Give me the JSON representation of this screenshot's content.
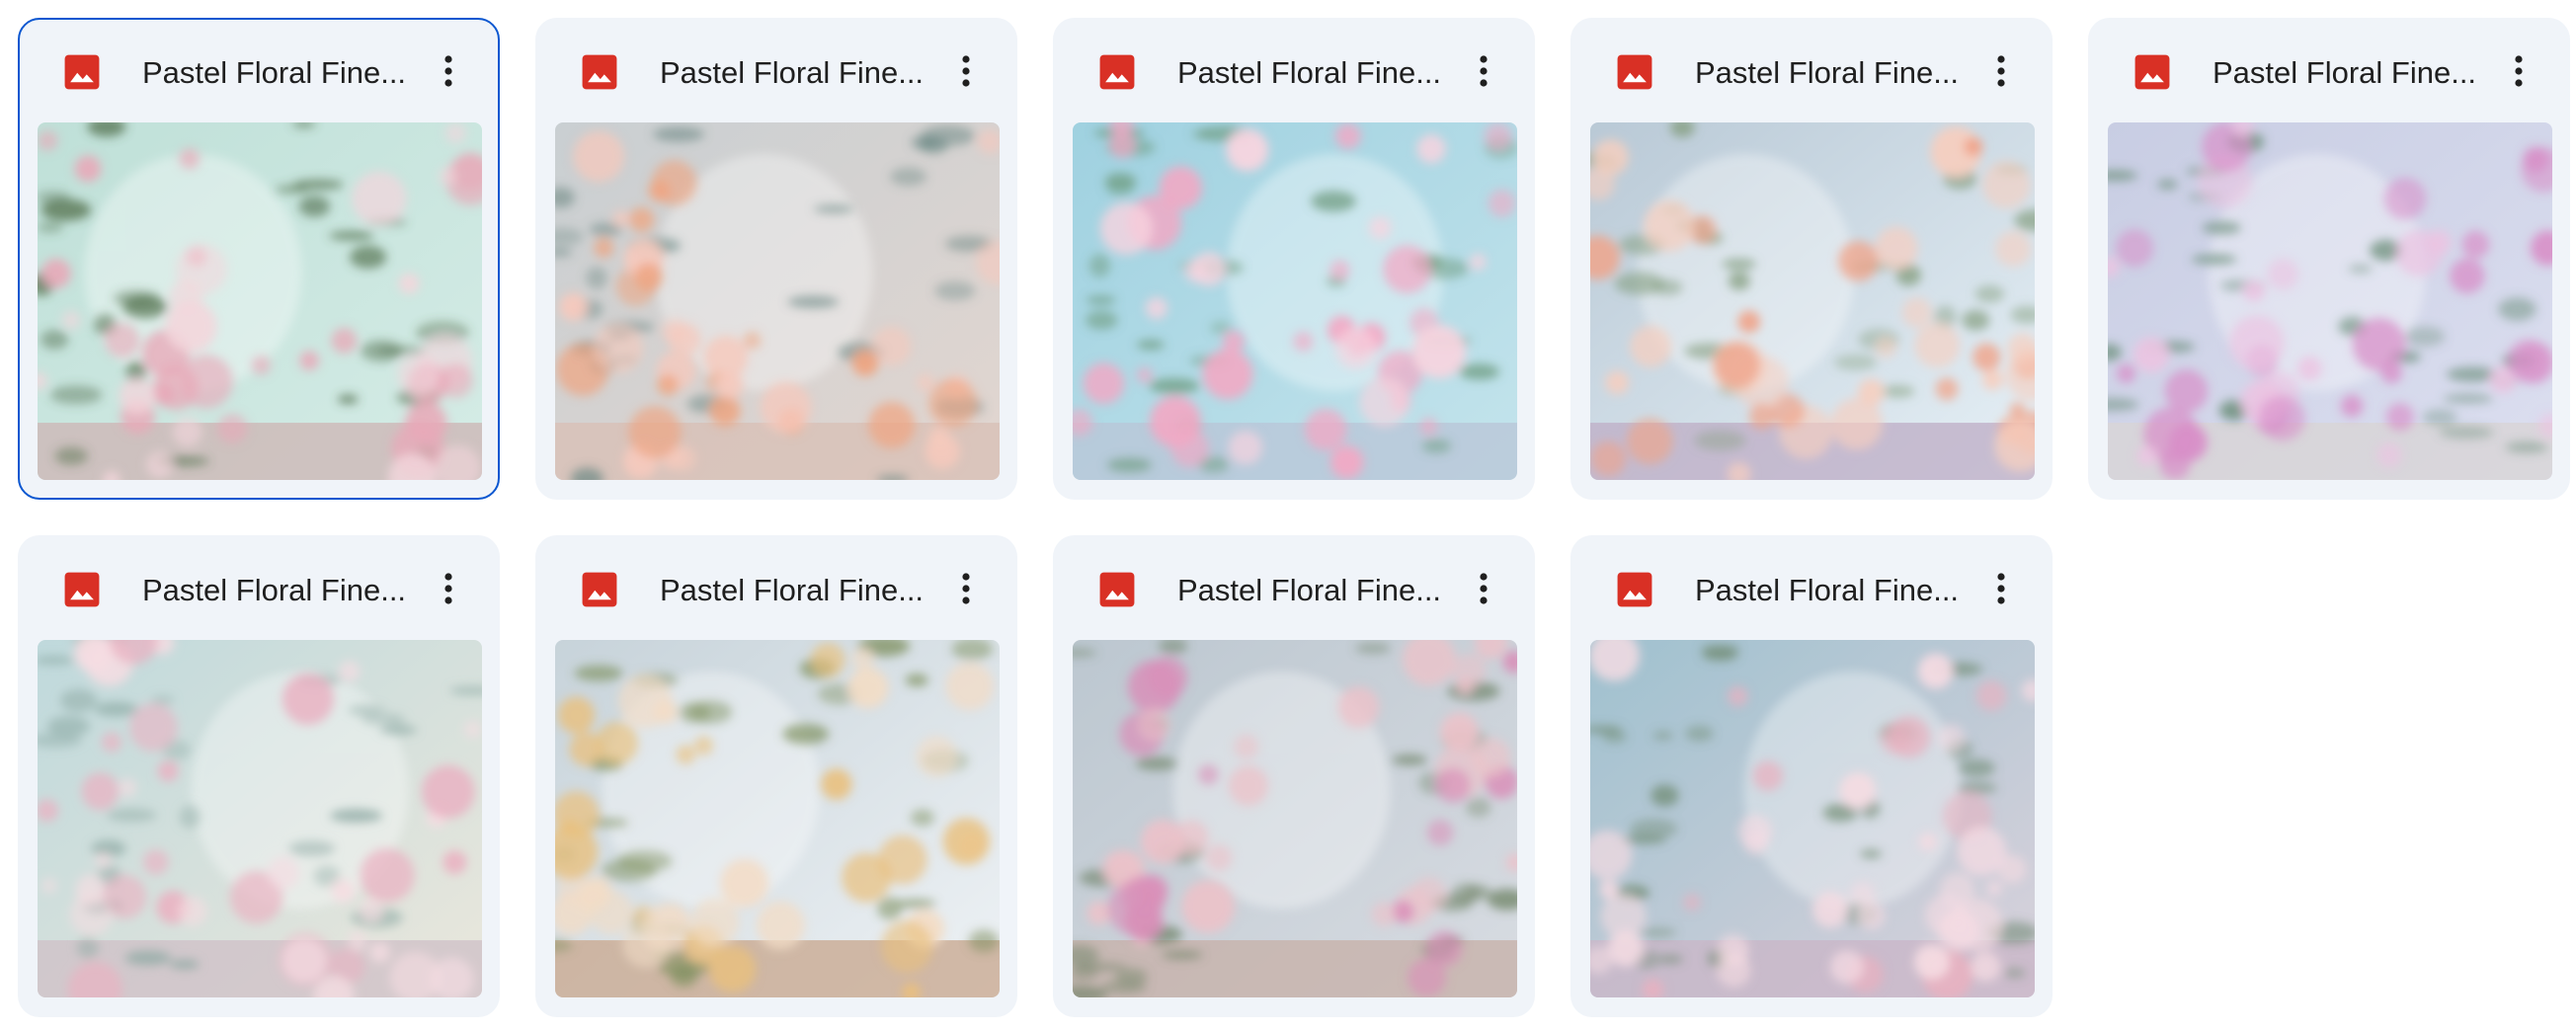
{
  "files": [
    {
      "title": "Pastel Floral Fine...",
      "selected": true,
      "icon": "image-file-icon",
      "palette": {
        "bg1": "#bfe0d8",
        "bg2": "#d5ece6",
        "flower1": "#e8a9b8",
        "flower2": "#f3d6dc",
        "leaf": "#4d6b47",
        "floor": "#cdb8b6"
      }
    },
    {
      "title": "Pastel Floral Fine...",
      "selected": false,
      "icon": "image-file-icon",
      "palette": {
        "bg1": "#c9cfd2",
        "bg2": "#e2d6d0",
        "flower1": "#eea582",
        "flower2": "#f5c9bd",
        "leaf": "#6f8a86",
        "floor": "#d8c0b6"
      }
    },
    {
      "title": "Pastel Floral Fine...",
      "selected": false,
      "icon": "image-file-icon",
      "palette": {
        "bg1": "#9fd1e0",
        "bg2": "#c4e4ec",
        "flower1": "#f2a8c4",
        "flower2": "#f8d4df",
        "leaf": "#6c9a7d",
        "floor": "#b9c7d8"
      }
    },
    {
      "title": "Pastel Floral Fine...",
      "selected": false,
      "icon": "image-file-icon",
      "palette": {
        "bg1": "#b9c9d6",
        "bg2": "#e6f0f6",
        "flower1": "#f0a48a",
        "flower2": "#f6cfc0",
        "leaf": "#7f9a78",
        "floor": "#bfb0c8"
      }
    },
    {
      "title": "Pastel Floral Fine...",
      "selected": false,
      "icon": "image-file-icon",
      "palette": {
        "bg1": "#c8cde3",
        "bg2": "#dcdff0",
        "flower1": "#d88fc8",
        "flower2": "#ecc4e2",
        "leaf": "#6b8e7a",
        "floor": "#d8d4d6"
      }
    },
    {
      "title": "Pastel Floral Fine...",
      "selected": false,
      "icon": "image-file-icon",
      "palette": {
        "bg1": "#bfd9dc",
        "bg2": "#eae7dc",
        "flower1": "#eab2c2",
        "flower2": "#f5dde2",
        "leaf": "#89a6a0",
        "floor": "#cfc2c8"
      }
    },
    {
      "title": "Pastel Floral Fine...",
      "selected": false,
      "icon": "image-file-icon",
      "palette": {
        "bg1": "#c7d3da",
        "bg2": "#eef2f5",
        "flower1": "#e9c07e",
        "flower2": "#f2dcc6",
        "leaf": "#7c8e5c",
        "floor": "#c9aa92"
      }
    },
    {
      "title": "Pastel Floral Fine...",
      "selected": false,
      "icon": "image-file-icon",
      "palette": {
        "bg1": "#bcc7d0",
        "bg2": "#d8dce2",
        "flower1": "#d98fb8",
        "flower2": "#ecc2c9",
        "leaf": "#6b7f62",
        "floor": "#c7b2aa"
      }
    },
    {
      "title": "Pastel Floral Fine...",
      "selected": false,
      "icon": "image-file-icon",
      "palette": {
        "bg1": "#9fc1cf",
        "bg2": "#dad2dc",
        "flower1": "#e8b1c0",
        "flower2": "#f4dbe2",
        "leaf": "#6f8a72",
        "floor": "#c9b6c8"
      }
    }
  ],
  "more_icon": "more-vert-icon",
  "colors": {
    "card_bg": "#f0f4f9",
    "selected_border": "#0b57d0",
    "image_icon_red": "#d93025",
    "text": "#1f1f1f"
  }
}
